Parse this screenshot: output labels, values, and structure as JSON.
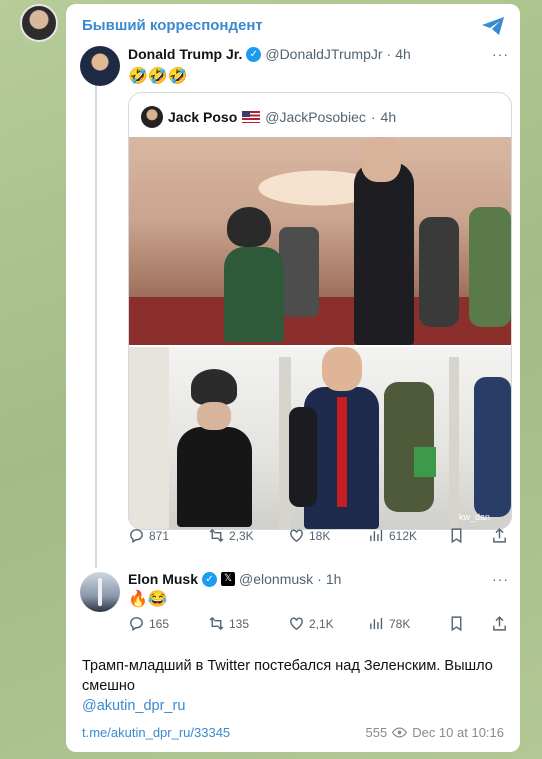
{
  "channel": {
    "name": "Бывший корреспондент"
  },
  "tweet_main": {
    "name": "Donald Trump Jr.",
    "handle": "@DonaldJTrumpJr",
    "time": "4h",
    "emojis": "🤣🤣🤣",
    "quote": {
      "name": "Jack Poso",
      "handle": "@JackPosobiec",
      "time": "4h",
      "watermark": "kw_dan"
    },
    "stats": {
      "replies": "871",
      "retweets": "2,3K",
      "likes": "18K",
      "views": "612K"
    }
  },
  "tweet_reply": {
    "name": "Elon Musk",
    "handle": "@elonmusk",
    "time": "1h",
    "emojis": "🔥😂",
    "stats": {
      "replies": "165",
      "retweets": "135",
      "likes": "2,1K",
      "views": "78K"
    }
  },
  "message": {
    "text": "Трамп-младший в Twitter постебался над Зеленским. Вышло смешно",
    "mention": "@akutin_dpr_ru",
    "link": "t.me/akutin_dpr_ru/33345",
    "views": "555",
    "timestamp": "Dec 10 at 10:16"
  },
  "colors": {
    "accent": "#3a8ad0",
    "verified": "#1d9bf0",
    "background": "#a9c08f"
  },
  "icons": [
    "share-icon",
    "verified-icon",
    "x-icon",
    "flag-us-icon",
    "reply-icon",
    "retweet-icon",
    "like-icon",
    "views-icon",
    "bookmark-icon",
    "upload-icon",
    "eye-icon"
  ]
}
